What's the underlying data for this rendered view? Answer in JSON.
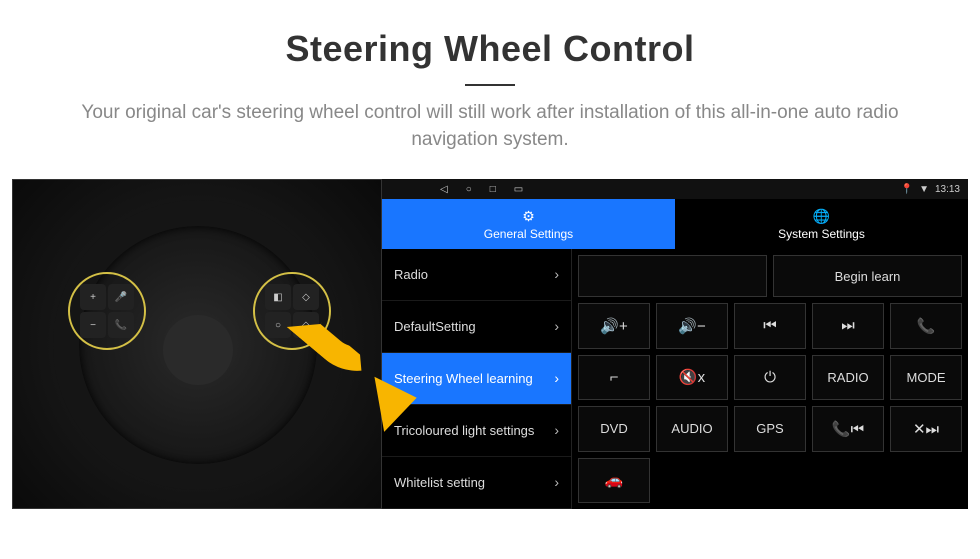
{
  "header": {
    "title": "Steering Wheel Control",
    "subtitle": "Your original car's steering wheel control will still work after installation of this all-in-one auto radio navigation system."
  },
  "status": {
    "time": "13:13"
  },
  "tabs": {
    "general": "General Settings",
    "system": "System Settings"
  },
  "sidebar": {
    "items": [
      {
        "label": "Radio"
      },
      {
        "label": "DefaultSetting"
      },
      {
        "label": "Steering Wheel learning"
      },
      {
        "label": "Tricoloured light settings"
      },
      {
        "label": "Whitelist setting"
      }
    ]
  },
  "actions": {
    "begin": "Begin learn"
  },
  "buttons": [
    {
      "id": "vol-up",
      "label": "🔊+",
      "type": "icon"
    },
    {
      "id": "vol-down",
      "label": "🔊−",
      "type": "icon"
    },
    {
      "id": "prev",
      "label": "⏮",
      "type": "icon"
    },
    {
      "id": "next",
      "label": "⏭",
      "type": "icon"
    },
    {
      "id": "phone",
      "label": "📞",
      "type": "icon"
    },
    {
      "id": "hangup",
      "label": "⌐📞",
      "type": "icon"
    },
    {
      "id": "mute",
      "label": "🔇x",
      "type": "icon"
    },
    {
      "id": "power",
      "label": "⏻",
      "type": "icon"
    },
    {
      "id": "radio",
      "label": "RADIO",
      "type": "text"
    },
    {
      "id": "mode",
      "label": "MODE",
      "type": "text"
    },
    {
      "id": "dvd",
      "label": "DVD",
      "type": "text"
    },
    {
      "id": "audio",
      "label": "AUDIO",
      "type": "text"
    },
    {
      "id": "gps",
      "label": "GPS",
      "type": "text"
    },
    {
      "id": "call-prev",
      "label": "📞⏮",
      "type": "icon"
    },
    {
      "id": "call-next",
      "label": "✕📞⏭",
      "type": "icon"
    },
    {
      "id": "car",
      "label": "🚗",
      "type": "icon"
    }
  ]
}
